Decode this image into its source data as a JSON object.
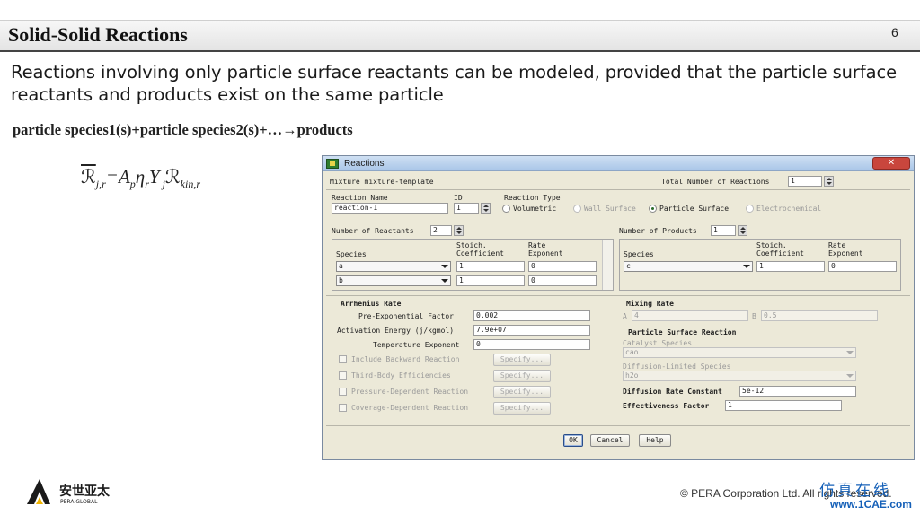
{
  "slide": {
    "title": "Solid-Solid Reactions",
    "page_number": "6",
    "intro": "Reactions involving only particle surface reactants can be modeled, provided that the particle surface reactants and products exist on the same particle",
    "reaction_equation": "particle species1(s)+particle species2(s)+…→products"
  },
  "dialog": {
    "title": "Reactions",
    "mixture_label": "Mixture mixture-template",
    "total_reactions_label": "Total Number of Reactions",
    "total_reactions_value": "1",
    "reaction_name_label": "Reaction Name",
    "reaction_name_value": "reaction-1",
    "id_label": "ID",
    "id_value": "1",
    "reaction_type_label": "Reaction Type",
    "reaction_types": [
      "Volumetric",
      "Wall Surface",
      "Particle Surface",
      "Electrochemical"
    ],
    "selected_reaction_type": "Particle Surface",
    "num_reactants_label": "Number of Reactants",
    "num_reactants_value": "2",
    "num_products_label": "Number of Products",
    "num_products_value": "1",
    "col_species": "Species",
    "col_stoich_1": "Stoich.",
    "col_stoich_2": "Coefficient",
    "col_rate_1": "Rate",
    "col_rate_2": "Exponent",
    "reactants": [
      {
        "species": "a",
        "stoich": "1",
        "rate": "0"
      },
      {
        "species": "b",
        "stoich": "1",
        "rate": "0"
      }
    ],
    "products": [
      {
        "species": "c",
        "stoich": "1",
        "rate": "0"
      }
    ],
    "arrhenius_label": "Arrhenius Rate",
    "pre_exp_label": "Pre-Exponential Factor",
    "pre_exp_value": "0.002",
    "activation_label": "Activation Energy (j/kgmol)",
    "activation_value": "7.9e+07",
    "temp_exp_label": "Temperature Exponent",
    "temp_exp_value": "0",
    "options": [
      {
        "label": "Include Backward Reaction",
        "button": "Specify..."
      },
      {
        "label": "Third-Body Efficiencies",
        "button": "Specify..."
      },
      {
        "label": "Pressure-Dependent Reaction",
        "button": "Specify..."
      },
      {
        "label": "Coverage-Dependent Reaction",
        "button": "Specify..."
      }
    ],
    "mixing_rate_label": "Mixing Rate",
    "mixing_a_label": "A",
    "mixing_a_value": "4",
    "mixing_b_label": "B",
    "mixing_b_value": "0.5",
    "psr_label": "Particle Surface Reaction",
    "catalyst_label": "Catalyst Species",
    "catalyst_value": "cao",
    "diffusion_species_label": "Diffusion-Limited Species",
    "diffusion_species_value": "h2o",
    "diffusion_const_label": "Diffusion Rate Constant",
    "diffusion_const_value": "5e-12",
    "effectiveness_label": "Effectiveness Factor",
    "effectiveness_value": "1",
    "ok_label": "OK",
    "cancel_label": "Cancel",
    "help_label": "Help"
  },
  "footer": {
    "logo_text_cn": "安世亚太",
    "logo_text_en": "PERA GLOBAL",
    "copyright": "© PERA Corporation Ltd. All rights reserved.",
    "watermark_cn": "仿真在线",
    "watermark_url": "www.1CAE.com"
  },
  "colors": {
    "dialog_bg": "#ece9d8",
    "title_rule": "#444444",
    "watermark": "#1560b8",
    "logo": "#1a1a1a"
  }
}
